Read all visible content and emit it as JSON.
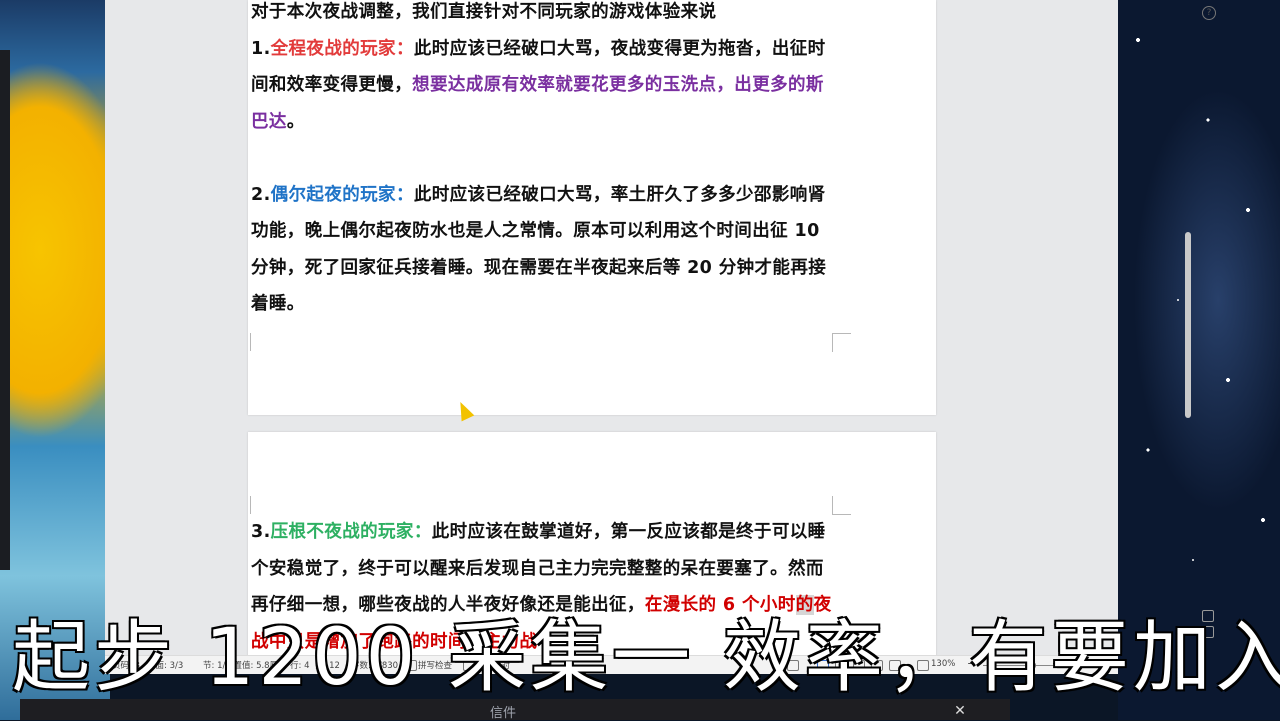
{
  "document": {
    "page1": {
      "intro": "对于本次夜战调整，我们直接针对不同玩家的游戏体验来说",
      "p1": {
        "num": "1.",
        "head": "全程夜战的玩家",
        "colon": "：",
        "text_a": "此时应该已经破口大骂，夜战变得更为拖沓，出征时间和效率变得更慢，",
        "text_b": "想要达成原有效率就要花更多的玉洗点，出更多的斯巴达",
        "end": "。"
      },
      "p2": {
        "num": "2.",
        "head": "偶尔起夜的玩家",
        "colon": "：",
        "text": "此时应该已经破口大骂，率土肝久了多多少邵影响肾功能，晚上偶尔起夜防水也是人之常情。原本可以利用这个时间出征 10 分钟，死了回家征兵接着睡。现在需要在半夜起来后等 20 分钟才能再接着睡。"
      }
    },
    "page2": {
      "p3": {
        "num": "3.",
        "head": "压根不夜战的玩家",
        "colon": "：",
        "text_a": "此时应该在鼓掌道好，第一反应该都是终于可以睡个安稳觉了，终于可以醒来后发现自己主力完完整整的呆在要塞了。然而再仔细一想，哪些夜战的人半夜好像还是能出征，",
        "text_b_1": "在漫长的 6 个小时",
        "text_b_hl": "的",
        "text_b_2": "夜战中只是增加了跑路的时间，主力战"
      }
    }
  },
  "statusbar": {
    "page_code": "页码: 3",
    "page": "页面: 3/3",
    "section": "节: 1/1",
    "setting": "设置值: 5.8厘米",
    "row": "行: 4",
    "col": "列: 12",
    "wordcount": "字数: 1/830",
    "spellcheck": "拼写检查",
    "doc_proof": "文档校对",
    "zoom": "130%",
    "zoom_minus": "−",
    "zoom_plus": "+"
  },
  "subtitle": "起步 1200 采集一 效率，有要加入",
  "taskbar": {
    "label": "信件"
  },
  "icons": {
    "help": "question-circle-icon"
  }
}
